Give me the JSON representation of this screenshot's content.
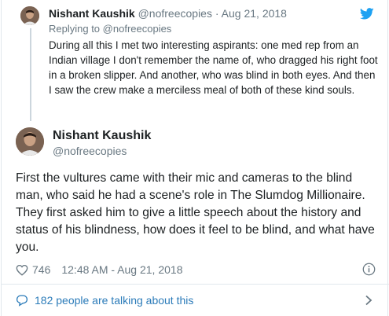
{
  "parent_tweet": {
    "author_name": "Nishant Kaushik",
    "handle": "@nofreecopies",
    "separator": "·",
    "date": "Aug 21, 2018",
    "replying_to_label": "Replying to",
    "replying_to_handle": "@nofreecopies",
    "text": "During all this I met two interesting aspirants: one med rep from an Indian village I don't remember the name of, who dragged his right foot in a broken slipper. And another, who was blind in both eyes. And then I saw the crew make a merciless meal of both of these kind souls."
  },
  "main_tweet": {
    "author_name": "Nishant Kaushik",
    "handle": "@nofreecopies",
    "text": "First the vultures came with their mic and cameras to the blind man, who said he had a scene's role in The Slumdog Millionaire. They first asked him to give a little speech about the history and status of his blindness, how does it feel to be blind, and what have you.",
    "likes": "746",
    "timestamp": "12:48 AM - Aug 21, 2018"
  },
  "footer": {
    "talking_label": "182 people are talking about this"
  },
  "icons": {
    "brand": "twitter-bird-icon",
    "like": "heart-icon",
    "info": "info-icon",
    "talk": "speech-bubble-icon",
    "more": "chevron-right-icon"
  },
  "colors": {
    "brand_blue": "#1da1f2",
    "link_blue": "#2b7bb9",
    "secondary_text": "#697882",
    "primary_text": "#1c2022",
    "border": "#e1e8ed"
  }
}
